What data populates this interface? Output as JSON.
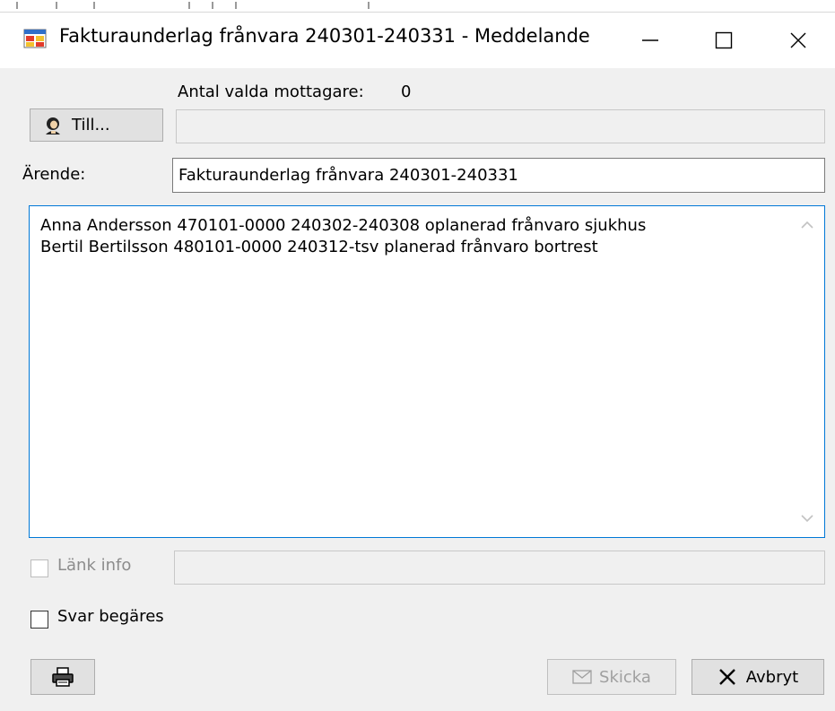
{
  "window": {
    "title": "Fakturaunderlag frånvara 240301-240331 - Meddelande",
    "app_icon": "form-window-icon",
    "minimize_icon": "minimize-icon",
    "maximize_icon": "maximize-icon",
    "close_icon": "close-icon"
  },
  "recipients": {
    "count_label": "Antal valda mottagare:",
    "count_value": "0",
    "to_button_label": "Till...",
    "to_button_icon": "address-book-icon",
    "to_value": ""
  },
  "subject": {
    "label": "Ärende:",
    "value": "Fakturaunderlag frånvara 240301-240331"
  },
  "body": {
    "lines": [
      "Anna Andersson 470101-0000 240302-240308 oplanerad frånvaro sjukhus",
      "Bertil Bertilsson 480101-0000 240312-tsv planerad frånvaro bortrest"
    ]
  },
  "link_info": {
    "label": "Länk info",
    "checked": false,
    "enabled": false,
    "value": ""
  },
  "reply_requested": {
    "label": "Svar begäres",
    "checked": false
  },
  "buttons": {
    "print_icon": "printer-icon",
    "send_label": "Skicka",
    "send_icon": "envelope-icon",
    "send_enabled": false,
    "cancel_label": "Avbryt",
    "cancel_icon": "x-icon"
  },
  "colors": {
    "window_bg": "#f0f0f0",
    "focus_border": "#0078d7",
    "disabled_text": "#a0a0a0"
  }
}
